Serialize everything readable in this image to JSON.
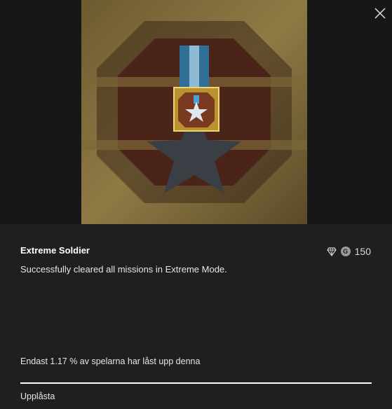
{
  "achievement": {
    "title": "Extreme Soldier",
    "description": "Successfully cleared all missions in Extreme Mode.",
    "gamerscore": "150",
    "gamerscore_badge": "G",
    "rarity_text": "Endast 1.17 % av spelarna har låst upp denna",
    "status": "Upplåsta",
    "unlock_progress": 1.0
  },
  "icons": {
    "close": "close-icon",
    "rarity": "diamond-icon",
    "gamerscore": "gamerscore-icon",
    "art": "medal-icon"
  },
  "colors": {
    "background": "#1f1f1f",
    "hero_background": "#171717",
    "frame_gold": "#8a733f",
    "medal_ribbon": "#2f6f96",
    "text": "#ffffff"
  }
}
